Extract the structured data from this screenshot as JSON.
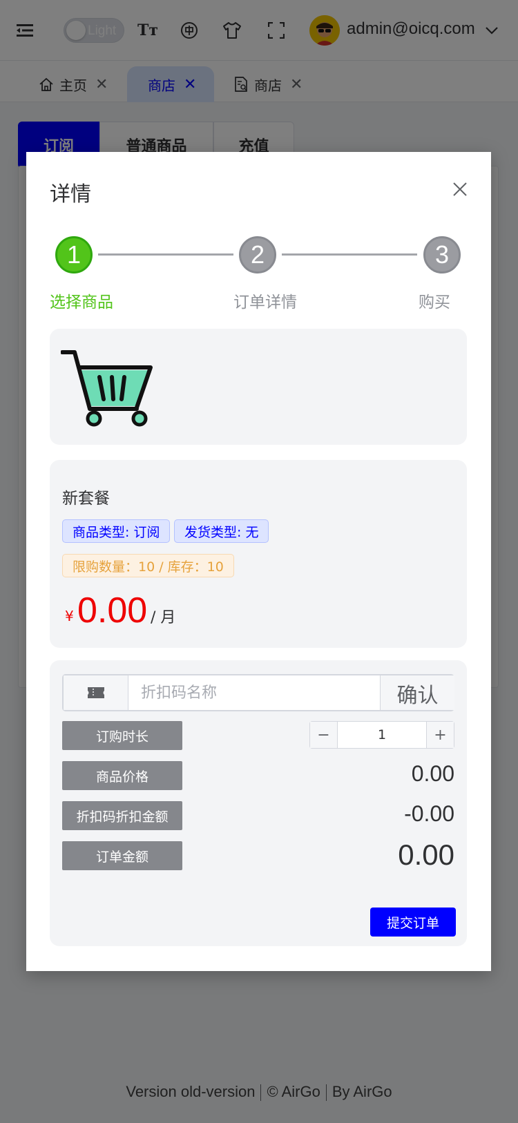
{
  "header": {
    "theme_label": "Light",
    "font_icon": "Tт",
    "user_email": "admin@oicq.com"
  },
  "tabs": [
    {
      "label": "主页"
    },
    {
      "label": "商店"
    },
    {
      "label": "商店"
    }
  ],
  "background": {
    "segments": [
      "订阅",
      "普通商品",
      "充值"
    ]
  },
  "dialog": {
    "title": "详情",
    "steps": [
      {
        "number": "1",
        "label": "选择商品"
      },
      {
        "number": "2",
        "label": "订单详情"
      },
      {
        "number": "3",
        "label": "购买"
      }
    ],
    "product": {
      "name": "新套餐",
      "tag_type": "商品类型: 订阅",
      "tag_ship": "发货类型: 无",
      "tag_limit": "限购数量：10 / 库存：10",
      "currency": "¥",
      "price": "0.00",
      "unit": "/ 月"
    },
    "order": {
      "coupon_placeholder": "折扣码名称",
      "coupon_confirm": "确认",
      "duration_label": "订购时长",
      "duration_value": "1",
      "price_label": "商品价格",
      "price_value": "0.00",
      "discount_label": "折扣码折扣金额",
      "discount_value": "-0.00",
      "total_label": "订单金额",
      "total_value": "0.00",
      "submit_label": "提交订单"
    }
  },
  "footer": {
    "version": "Version old-version",
    "copyright": "© AirGo",
    "by": "By AirGo"
  },
  "colors": {
    "primary": "#0000ff",
    "success": "#52c41a",
    "price": "#ee0000",
    "warning": "#e6a23c"
  }
}
